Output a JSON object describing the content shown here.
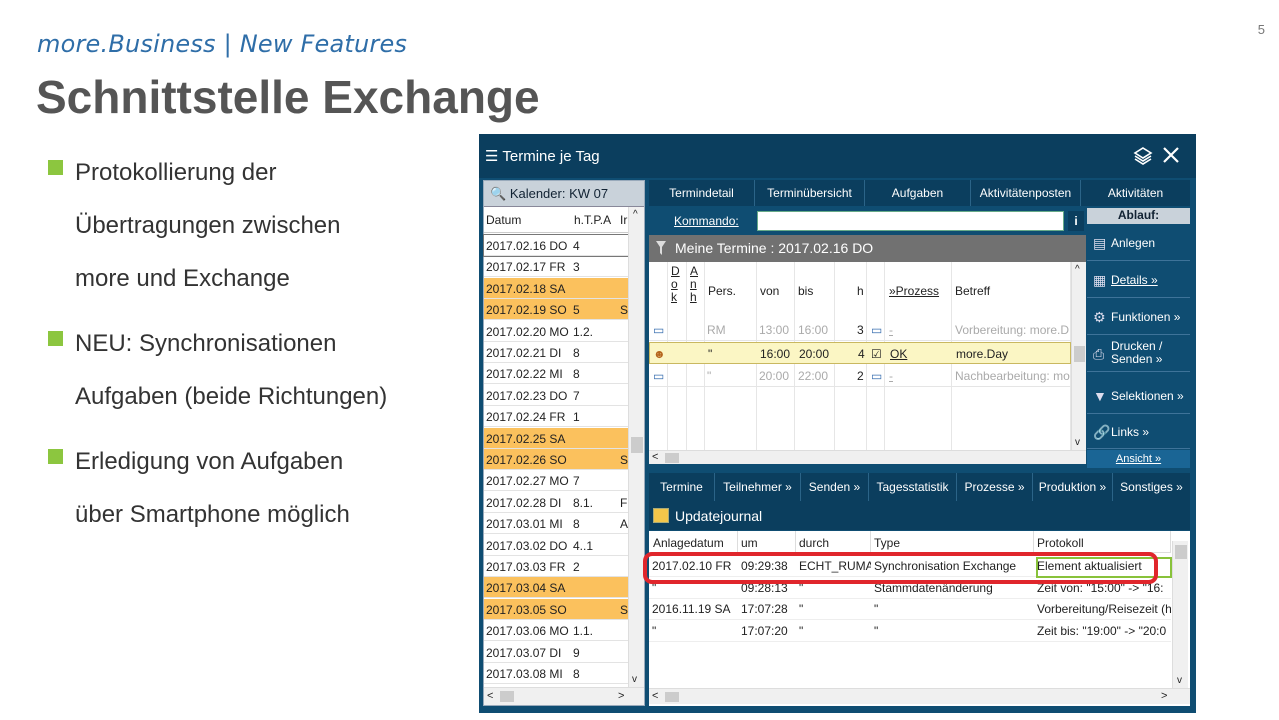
{
  "slide": {
    "number": "5",
    "subtitle": "more.Business | New Features",
    "title": "Schnittstelle Exchange",
    "bullets": [
      {
        "line1": "Protokollierung der",
        "line2": "Übertragungen zwischen",
        "line3": "more und Exchange"
      },
      {
        "line1": "NEU: Synchronisationen",
        "line2": "Aufgaben (beide Richtungen)"
      },
      {
        "line1": "Erledigung von Aufgaben",
        "line2": "über Smartphone möglich"
      }
    ],
    "accent_color": "#8cc63f",
    "subtitle_color": "#2f6ea8"
  },
  "window": {
    "title": "Termine je Tag",
    "icons": [
      "menu-icon",
      "layers-icon",
      "close-icon"
    ],
    "calendar": {
      "header": "Kalender: KW 07",
      "columns": [
        "Datum",
        "h.T.P.A",
        "Ir"
      ],
      "rows": [
        {
          "date": "2017.02.16 DO",
          "val": "4",
          "x": "",
          "weekend": false
        },
        {
          "date": "2017.02.17 FR",
          "val": "3",
          "x": "",
          "weekend": false
        },
        {
          "date": "2017.02.18 SA",
          "val": "",
          "x": "",
          "weekend": true
        },
        {
          "date": "2017.02.19 SO",
          "val": "5",
          "x": "S",
          "weekend": true
        },
        {
          "date": "2017.02.20 MO",
          "val": "1.2.",
          "x": "",
          "weekend": false
        },
        {
          "date": "2017.02.21 DI",
          "val": "8",
          "x": "",
          "weekend": false
        },
        {
          "date": "2017.02.22 MI",
          "val": "8",
          "x": "",
          "weekend": false
        },
        {
          "date": "2017.02.23 DO",
          "val": "7",
          "x": "",
          "weekend": false
        },
        {
          "date": "2017.02.24 FR",
          "val": "1",
          "x": "",
          "weekend": false
        },
        {
          "date": "2017.02.25 SA",
          "val": "",
          "x": "",
          "weekend": true
        },
        {
          "date": "2017.02.26 SO",
          "val": "",
          "x": "S",
          "weekend": true
        },
        {
          "date": "2017.02.27 MO",
          "val": "7",
          "x": "",
          "weekend": false
        },
        {
          "date": "2017.02.28 DI",
          "val": "8.1.",
          "x": "F",
          "weekend": false
        },
        {
          "date": "2017.03.01 MI",
          "val": "8",
          "x": "A",
          "weekend": false
        },
        {
          "date": "2017.03.02 DO",
          "val": "4..1",
          "x": "",
          "weekend": false
        },
        {
          "date": "2017.03.03 FR",
          "val": "2",
          "x": "",
          "weekend": false
        },
        {
          "date": "2017.03.04 SA",
          "val": "",
          "x": "",
          "weekend": true
        },
        {
          "date": "2017.03.05 SO",
          "val": "",
          "x": "S",
          "weekend": true
        },
        {
          "date": "2017.03.06 MO",
          "val": "1.1.",
          "x": "",
          "weekend": false
        },
        {
          "date": "2017.03.07 DI",
          "val": "9",
          "x": "",
          "weekend": false
        },
        {
          "date": "2017.03.08 MI",
          "val": "8",
          "x": "",
          "weekend": false
        }
      ]
    },
    "top_tabs": [
      "Termindetail",
      "Terminübersicht",
      "Aufgaben",
      "Aktivitätenposten",
      "Aktivitäten"
    ],
    "kommando": {
      "label": "Kommando:",
      "value": "",
      "info": "i"
    },
    "termine": {
      "header": "Meine Termine : 2017.02.16 DO",
      "columns": {
        "dok": "D\no\nk",
        "anh": "A\nn\nh",
        "pers": "Pers.",
        "von": "von",
        "bis": "bis",
        "h": "h",
        "prozess": "»Prozess",
        "betreff": "Betreff"
      },
      "rows": [
        {
          "pers": "RM",
          "von": "13:00",
          "bis": "16:00",
          "h": "3",
          "prozess": "-",
          "betreff": "Vorbereitung: more.D",
          "style": "grey"
        },
        {
          "pers": "\"",
          "von": "16:00",
          "bis": "20:00",
          "h": "4",
          "prozess": "OK",
          "betreff": "more.Day",
          "style": "hl"
        },
        {
          "pers": "\"",
          "von": "20:00",
          "bis": "22:00",
          "h": "2",
          "prozess": "-",
          "betreff": "Nachbearbeitung: mo",
          "style": "grey"
        }
      ]
    },
    "ablauf": {
      "title": "Ablauf:",
      "buttons": [
        "Anlegen",
        "Details »",
        "Funktionen »",
        "Drucken / Senden »",
        "Selektionen »",
        "Links »"
      ],
      "ansicht": "Ansicht »"
    },
    "bottom_tabs": [
      "Termine",
      "Teilnehmer »",
      "Senden »",
      "Tagesstatistik",
      "Prozesse »",
      "Produktion »",
      "Sonstiges »"
    ],
    "journal": {
      "header": "Updatejournal",
      "columns": [
        "Anlagedatum",
        "um",
        "durch",
        "Type",
        "Protokoll"
      ],
      "rows": [
        [
          "2017.02.10 FR",
          "09:29:38",
          "ECHT_RUMA",
          "Synchronisation Exchange",
          "Element aktualisiert"
        ],
        [
          "\"",
          "09:28:13",
          "\"",
          "Stammdatenänderung",
          "Zeit von: \"15:00\" -> \"16:"
        ],
        [
          "2016.11.19 SA",
          "17:07:28",
          "\"",
          "\"",
          "Vorbereitung/Reisezeit (h"
        ],
        [
          "\"",
          "17:07:20",
          "\"",
          "\"",
          "Zeit bis: \"19:00\" -> \"20:0"
        ]
      ]
    }
  }
}
